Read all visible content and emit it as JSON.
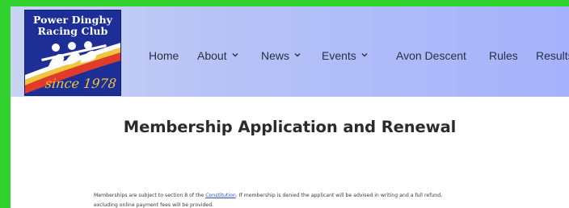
{
  "logo": {
    "line1": "Power Dinghy",
    "line2": "Racing Club",
    "since": "since 1978",
    "colors": {
      "background": "#1d2f97",
      "red": "#e23b2b",
      "yellow": "#f3c637",
      "white": "#ffffff"
    }
  },
  "nav": {
    "items": [
      {
        "label": "Home",
        "has_dropdown": false
      },
      {
        "label": "About",
        "has_dropdown": true,
        "icon": "chevron-down-icon"
      },
      {
        "label": "News",
        "has_dropdown": true,
        "icon": "chevron-down-icon"
      },
      {
        "label": "Events",
        "has_dropdown": true,
        "icon": "chevron-down-icon"
      },
      {
        "label": "Avon Descent",
        "has_dropdown": false
      },
      {
        "label": "Rules",
        "has_dropdown": false
      },
      {
        "label": "Results",
        "has_dropdown": false
      }
    ]
  },
  "main": {
    "title": "Membership Application and Renewal",
    "paragraph": {
      "before": "Memberships are subject to section 8 of the ",
      "link": "Constitution",
      "after_line1": ". If membership is denied the applicant will be advised in writing and a full refund,",
      "line2": "excluding online payment fees will be provided."
    }
  },
  "colors": {
    "outer_border": "#31d12e",
    "header_gradient_start": "#c9d3f3",
    "header_gradient_end": "#a6b2fb",
    "link": "#2a52c9"
  }
}
